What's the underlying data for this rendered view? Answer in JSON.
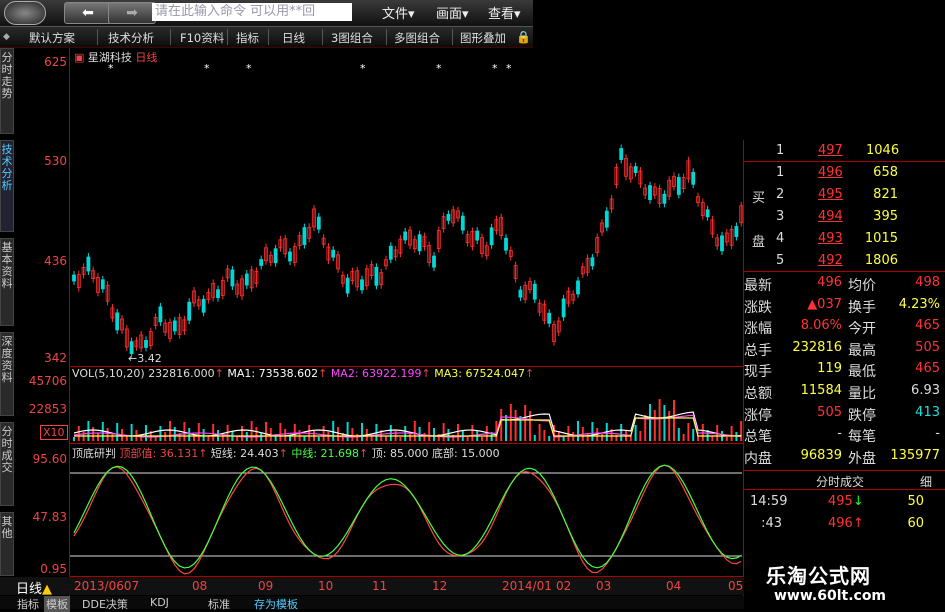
{
  "toolbar": {
    "back_icon": "left-arrow",
    "forward_icon": "right-arrow",
    "command_placeholder": "请在此输入命令  可以用**回",
    "menus": [
      "文件▾",
      "画面▾",
      "查看▾"
    ]
  },
  "toolbar2": {
    "items": [
      "默认方案",
      "技术分析",
      "F10资料",
      "指标",
      "日线",
      "3图组合",
      "多图组合",
      "图形叠加"
    ]
  },
  "left_tabs": [
    "分时走势",
    "技术分析",
    "基本资料",
    "深度资料",
    "分时成交",
    "其他"
  ],
  "main_chart": {
    "title_stock": "星湖科技",
    "title_period": "日线",
    "y_labels": [
      "625",
      "530",
      "436",
      "342"
    ],
    "low_label": "3.42"
  },
  "vol_panel": {
    "header": "VOL(5,10,20)",
    "vol": "232816.000",
    "ma1_label": "MA1: 73538.602",
    "ma2_label": "MA2: 63922.199",
    "ma3_label": "MA3: 67524.047",
    "y_labels": [
      "45706",
      "22853"
    ],
    "unit": "X10"
  },
  "ind_panel": {
    "name": "顶底研判",
    "t1": "顶部值: 36.131",
    "t2": "短线: 24.403",
    "t3": "中线: 21.698",
    "t4": "顶: 85.000",
    "t5": "底部: 15.000",
    "y_labels": [
      "95.60",
      "47.83",
      "0.95"
    ]
  },
  "x_axis": {
    "left_label": "日线",
    "dates": [
      "2013/0607",
      "08",
      "09",
      "10",
      "11",
      "12",
      "2014/01",
      "02",
      "03",
      "04",
      "05"
    ]
  },
  "bottom_tabs": [
    "指标",
    "模板",
    "DDE决策",
    "KDJ",
    "标准",
    "存为模板"
  ],
  "quote": {
    "sell_rows": [
      {
        "lvl": "1",
        "price": "497",
        "vol": "1046"
      }
    ],
    "buy_label": "买",
    "pan_label": "盘",
    "buy_rows": [
      {
        "lvl": "1",
        "price": "496",
        "vol": "658"
      },
      {
        "lvl": "2",
        "price": "495",
        "vol": "821"
      },
      {
        "lvl": "3",
        "price": "494",
        "vol": "395"
      },
      {
        "lvl": "4",
        "price": "493",
        "vol": "1015"
      },
      {
        "lvl": "5",
        "price": "492",
        "vol": "1806"
      }
    ],
    "stats": [
      {
        "l1": "最新",
        "v1": "496",
        "l2": "均价",
        "v2": "498"
      },
      {
        "l1": "涨跌",
        "v1": "▲037",
        "l2": "换手",
        "v2": "4.23%"
      },
      {
        "l1": "涨幅",
        "v1": "8.06%",
        "l2": "今开",
        "v2": "465"
      },
      {
        "l1": "总手",
        "v1": "232816",
        "l2": "最高",
        "v2": "505"
      },
      {
        "l1": "现手",
        "v1": "119",
        "l2": "最低",
        "v2": "465"
      },
      {
        "l1": "总额",
        "v1": "11584",
        "l2": "量比",
        "v2": "6.93"
      },
      {
        "l1": "涨停",
        "v1": "505",
        "l2": "跌停",
        "v2": "413"
      },
      {
        "l1": "总笔",
        "v1": "-",
        "l2": "每笔",
        "v2": "-"
      },
      {
        "l1": "内盘",
        "v1": "96839",
        "l2": "外盘",
        "v2": "135977"
      }
    ],
    "trades_header": "分时成交",
    "trades_tab": "细",
    "trades": [
      {
        "time": "14:59",
        "price": "495",
        "arrow": "↓",
        "vol": "50"
      },
      {
        "time": ":43",
        "price": "496",
        "arrow": "↑",
        "vol": "60"
      },
      {
        "time": "",
        "price": "",
        "arrow": "",
        "vol": ""
      }
    ]
  },
  "watermark": {
    "name": "乐淘公式网",
    "url": "www.60lt.com"
  },
  "colors": {
    "up": "#ff3030",
    "down": "#00d8d8",
    "ma1": "#ffffff",
    "ma2": "#ff44ff",
    "ma3": "#ffff44",
    "line_green": "#44ff44",
    "line_red": "#ff4444"
  }
}
